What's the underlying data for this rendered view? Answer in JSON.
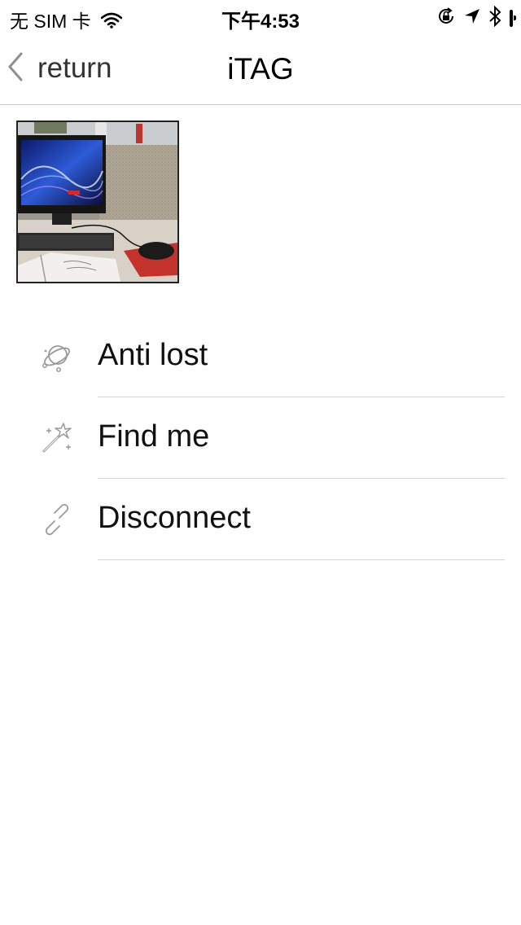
{
  "status_bar": {
    "carrier": "无 SIM 卡",
    "time": "下午4:53",
    "icons": [
      "wifi-icon",
      "rotation-lock-icon",
      "location-icon",
      "bluetooth-icon",
      "battery-icon"
    ]
  },
  "nav": {
    "back_label": "return",
    "title": "iTAG"
  },
  "device_photo": {
    "description": "desk-photo-thumbnail"
  },
  "menu": {
    "items": [
      {
        "label": "Anti lost",
        "icon": "planet-icon"
      },
      {
        "label": "Find me",
        "icon": "magic-wand-icon"
      },
      {
        "label": "Disconnect",
        "icon": "broken-link-icon"
      }
    ]
  },
  "colors": {
    "divider": "#d3d3d3",
    "icon_gray": "#9a9a9a",
    "background": "#ffffff"
  }
}
